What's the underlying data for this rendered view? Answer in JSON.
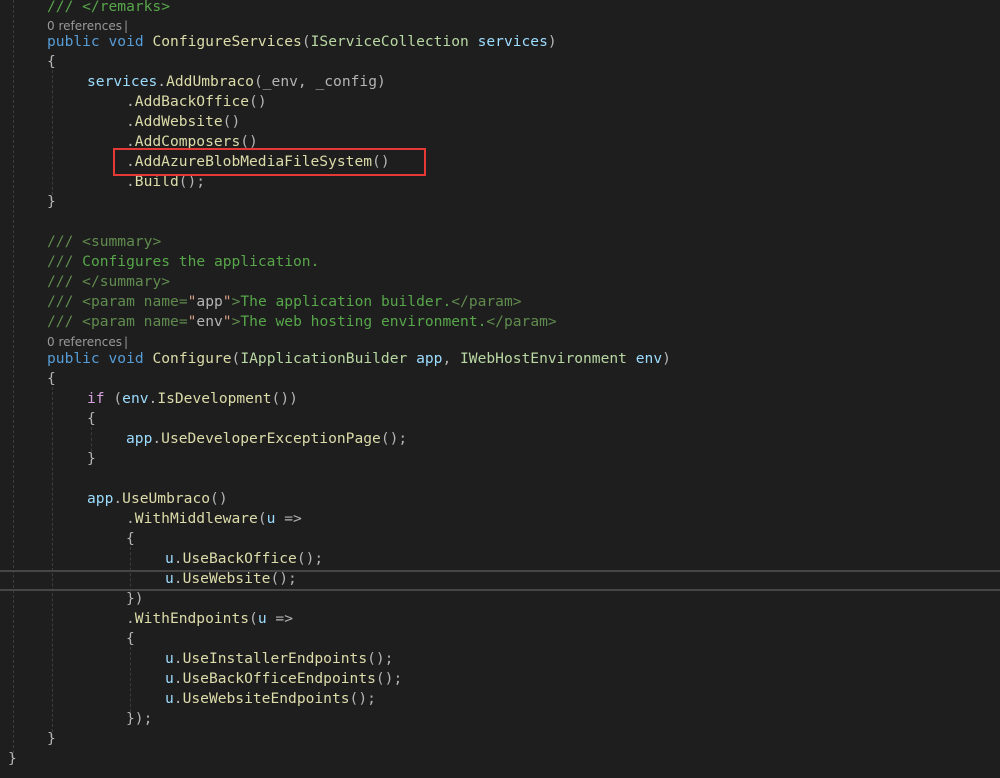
{
  "editor": {
    "theme_colors": {
      "background": "#1e1e1e",
      "keyword": "#569cd6",
      "control_keyword": "#d8a0df",
      "comment": "#57a64a",
      "method": "#dcdcaa",
      "parameter": "#9cdcfe",
      "highlight_box": "#e53935"
    },
    "code_lens": {
      "configure_services": "0 references",
      "configure": "0 references"
    },
    "lines": [
      [
        [
          "cm",
          "/// </remarks>"
        ]
      ],
      [
        [
          "kw",
          "public"
        ],
        [
          "pu",
          " "
        ],
        [
          "kw",
          "void"
        ],
        [
          "pu",
          " "
        ],
        [
          "fn",
          "ConfigureServices"
        ],
        [
          "pu",
          "("
        ],
        [
          "ty",
          "IServiceCollection"
        ],
        [
          "pu",
          " "
        ],
        [
          "pr",
          "services"
        ],
        [
          "pu",
          ")"
        ]
      ],
      [
        [
          "pu",
          "{"
        ]
      ],
      [
        [
          "pr",
          "services"
        ],
        [
          "pu",
          "."
        ],
        [
          "fn",
          "AddUmbraco"
        ],
        [
          "pu",
          "(_env, _config)"
        ]
      ],
      [
        [
          "pu",
          "."
        ],
        [
          "fn",
          "AddBackOffice"
        ],
        [
          "pu",
          "()"
        ]
      ],
      [
        [
          "pu",
          "."
        ],
        [
          "fn",
          "AddWebsite"
        ],
        [
          "pu",
          "()"
        ]
      ],
      [
        [
          "pu",
          "."
        ],
        [
          "fn",
          "AddComposers"
        ],
        [
          "pu",
          "()"
        ]
      ],
      [
        [
          "pu",
          "."
        ],
        [
          "fn",
          "AddAzureBlobMediaFileSystem"
        ],
        [
          "pu",
          "()"
        ]
      ],
      [
        [
          "pu",
          "."
        ],
        [
          "fn",
          "Build"
        ],
        [
          "pu",
          "();"
        ]
      ],
      [
        [
          "pu",
          "}"
        ]
      ],
      [
        [
          "xd",
          "/// "
        ],
        [
          "xd",
          "<summary>"
        ]
      ],
      [
        [
          "xd",
          "/// "
        ],
        [
          "cm",
          "Configures the application."
        ]
      ],
      [
        [
          "xd",
          "/// "
        ],
        [
          "xd",
          "</summary>"
        ]
      ],
      [
        [
          "xd",
          "/// "
        ],
        [
          "xd",
          "<param "
        ],
        [
          "xd",
          "name"
        ],
        [
          "xd",
          "="
        ],
        [
          "xq",
          "\""
        ],
        [
          "pu",
          "app"
        ],
        [
          "xq",
          "\""
        ],
        [
          "xd",
          ">"
        ],
        [
          "cm",
          "The application builder."
        ],
        [
          "xd",
          "</param>"
        ]
      ],
      [
        [
          "xd",
          "/// "
        ],
        [
          "xd",
          "<param "
        ],
        [
          "xd",
          "name"
        ],
        [
          "xd",
          "="
        ],
        [
          "xq",
          "\""
        ],
        [
          "pu",
          "env"
        ],
        [
          "xq",
          "\""
        ],
        [
          "xd",
          ">"
        ],
        [
          "cm",
          "The web hosting environment."
        ],
        [
          "xd",
          "</param>"
        ]
      ],
      [
        [
          "kw",
          "public"
        ],
        [
          "pu",
          " "
        ],
        [
          "kw",
          "void"
        ],
        [
          "pu",
          " "
        ],
        [
          "fn",
          "Configure"
        ],
        [
          "pu",
          "("
        ],
        [
          "ty",
          "IApplicationBuilder"
        ],
        [
          "pu",
          " "
        ],
        [
          "pr",
          "app"
        ],
        [
          "pu",
          ", "
        ],
        [
          "ty",
          "IWebHostEnvironment"
        ],
        [
          "pu",
          " "
        ],
        [
          "pr",
          "env"
        ],
        [
          "pu",
          ")"
        ]
      ],
      [
        [
          "pu",
          "{"
        ]
      ],
      [
        [
          "kwc",
          "if"
        ],
        [
          "pu",
          " ("
        ],
        [
          "pr",
          "env"
        ],
        [
          "pu",
          "."
        ],
        [
          "fn",
          "IsDevelopment"
        ],
        [
          "pu",
          "())"
        ]
      ],
      [
        [
          "pu",
          "{"
        ]
      ],
      [
        [
          "pr",
          "app"
        ],
        [
          "pu",
          "."
        ],
        [
          "fn",
          "UseDeveloperExceptionPage"
        ],
        [
          "pu",
          "();"
        ]
      ],
      [
        [
          "pu",
          "}"
        ]
      ],
      [
        [
          "pr",
          "app"
        ],
        [
          "pu",
          "."
        ],
        [
          "fn",
          "UseUmbraco"
        ],
        [
          "pu",
          "()"
        ]
      ],
      [
        [
          "pu",
          "."
        ],
        [
          "fn",
          "WithMiddleware"
        ],
        [
          "pu",
          "("
        ],
        [
          "pr",
          "u"
        ],
        [
          "pu",
          " =>"
        ]
      ],
      [
        [
          "pu",
          "{"
        ]
      ],
      [
        [
          "pr",
          "u"
        ],
        [
          "pu",
          "."
        ],
        [
          "fn",
          "UseBackOffice"
        ],
        [
          "pu",
          "();"
        ]
      ],
      [
        [
          "pr",
          "u"
        ],
        [
          "pu",
          "."
        ],
        [
          "fn",
          "UseWebsite"
        ],
        [
          "pu",
          "();"
        ]
      ],
      [
        [
          "pu",
          "})"
        ]
      ],
      [
        [
          "pu",
          "."
        ],
        [
          "fn",
          "WithEndpoints"
        ],
        [
          "pu",
          "("
        ],
        [
          "pr",
          "u"
        ],
        [
          "pu",
          " =>"
        ]
      ],
      [
        [
          "pu",
          "{"
        ]
      ],
      [
        [
          "pr",
          "u"
        ],
        [
          "pu",
          "."
        ],
        [
          "fn",
          "UseInstallerEndpoints"
        ],
        [
          "pu",
          "();"
        ]
      ],
      [
        [
          "pr",
          "u"
        ],
        [
          "pu",
          "."
        ],
        [
          "fn",
          "UseBackOfficeEndpoints"
        ],
        [
          "pu",
          "();"
        ]
      ],
      [
        [
          "pr",
          "u"
        ],
        [
          "pu",
          "."
        ],
        [
          "fn",
          "UseWebsiteEndpoints"
        ],
        [
          "pu",
          "();"
        ]
      ],
      [
        [
          "pu",
          "});"
        ]
      ],
      [
        [
          "pu",
          "}"
        ]
      ],
      [
        [
          "pu",
          "}"
        ]
      ]
    ]
  }
}
